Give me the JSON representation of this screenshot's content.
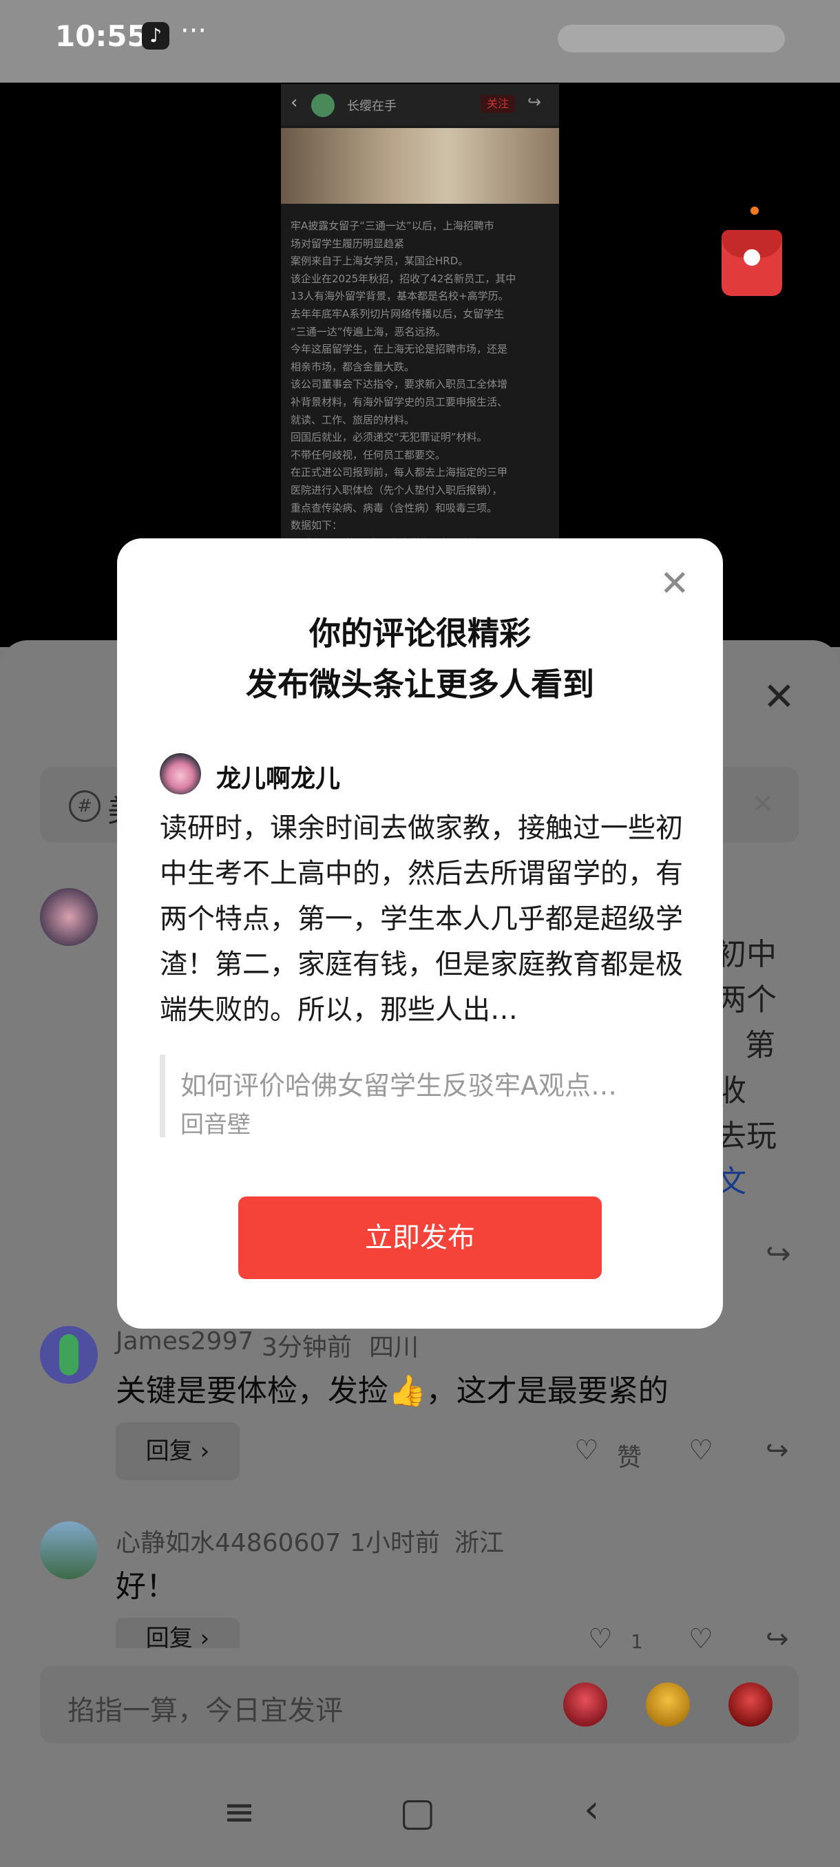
{
  "status_bar": {
    "time": "10:55",
    "tiktok_glyph": "♪",
    "more": "···"
  },
  "article": {
    "back": "‹",
    "author": "长缨在手",
    "follow": "关注",
    "share": "↪",
    "text": "牢A披露女留子“三通一达”以后，上海招聘市\n场对留学生履历明显趋紧\n案例来自于上海女学员，某国企HRD。\n该企业在2025年秋招，招收了42名新员工，其中\n13人有海外留学背景，基本都是名校+高学历。\n去年年底牢A系列切片网络传播以后，女留学生\n“三通一达”传遍上海，恶名远扬。\n今年这届留学生，在上海无论是招聘市场，还是\n相亲市场，都含金量大跌。\n该公司董事会下达指令，要求新入职员工全体增\n补背景材料，有海外留学史的员工要申报生活、\n就读、工作、旅居的材料。\n回国后就业，必须递交“无犯罪证明”材料。\n不带任何歧视，任何员工都要交。\n在正式进公司报到前，每人都去上海指定的三甲\n医院进行入职体检（先个人垫付入职后报销），\n重点查传染病、病毒（含性病）和吸毒三项。\n数据如下：\n42名新员工的29名国内大学生，都顺利报至："
  },
  "sheet": {
    "close": "✕",
    "topic_icon": "#",
    "topic_text": "美",
    "topic_close": "✕",
    "bg_right_lines": [
      "初中",
      "两个",
      "第",
      "收",
      "去玩",
      "文"
    ],
    "comments": [
      {
        "user": "James2997",
        "time": "3分钟前",
        "region": "四川",
        "text": "关键是要体检，发捡👍，这才是最要紧的",
        "reply": "回复 ›",
        "like_label": "赞"
      },
      {
        "user": "心静如水44860607",
        "time": "1小时前",
        "region": "浙江",
        "text": "好！",
        "reply": "回复 ›",
        "like_count": "1"
      }
    ],
    "input_placeholder": "掐指一算，今日宜发评",
    "icons": {
      "like": "♡",
      "dislike": "♡",
      "share": "↪"
    }
  },
  "nav": {
    "menu": "≡",
    "home": "▢",
    "back": "‹"
  },
  "modal": {
    "close": "✕",
    "title_line1": "你的评论很精彩",
    "title_line2": "发布微头条让更多人看到",
    "user_name": "龙儿啊龙儿",
    "body": "读研时，课余时间去做家教，接触过一些初中生考不上高中的，然后去所谓留学的，有两个特点，第一，学生本人几乎都是超级学渣！第二，家庭有钱，但是家庭教育都是极端失败的。所以，那些人出…",
    "quote_title": "如何评价哈佛女留学生反驳牢A观点…",
    "quote_source": "回音壁",
    "publish_button": "立即发布"
  }
}
